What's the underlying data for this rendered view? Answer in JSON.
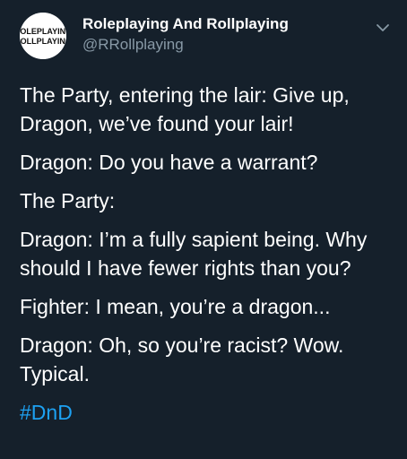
{
  "user": {
    "display_name": "Roleplaying And Rollplaying",
    "handle": "@RRollplaying",
    "avatar_text_line1": "ROLEPLAYING",
    "avatar_text_line2": "ROLLPLAYING",
    "avatar_icon": "logo-wordmark"
  },
  "menu_icon": "chevron-down-icon",
  "tweet": {
    "lines": [
      "The Party, entering the lair: Give up, Dragon, we’ve found your lair!",
      "Dragon: Do you have a warrant?",
      "The Party:",
      "Dragon: I’m a fully sapient being. Why should I have fewer rights than you?",
      "Fighter: I mean, you’re a dragon...",
      "Dragon: Oh, so you’re racist? Wow. Typical."
    ],
    "hashtag": "#DnD"
  },
  "colors": {
    "background": "#15202b",
    "text": "#ffffff",
    "secondary_text": "#8899a6",
    "link": "#1da1f2"
  }
}
